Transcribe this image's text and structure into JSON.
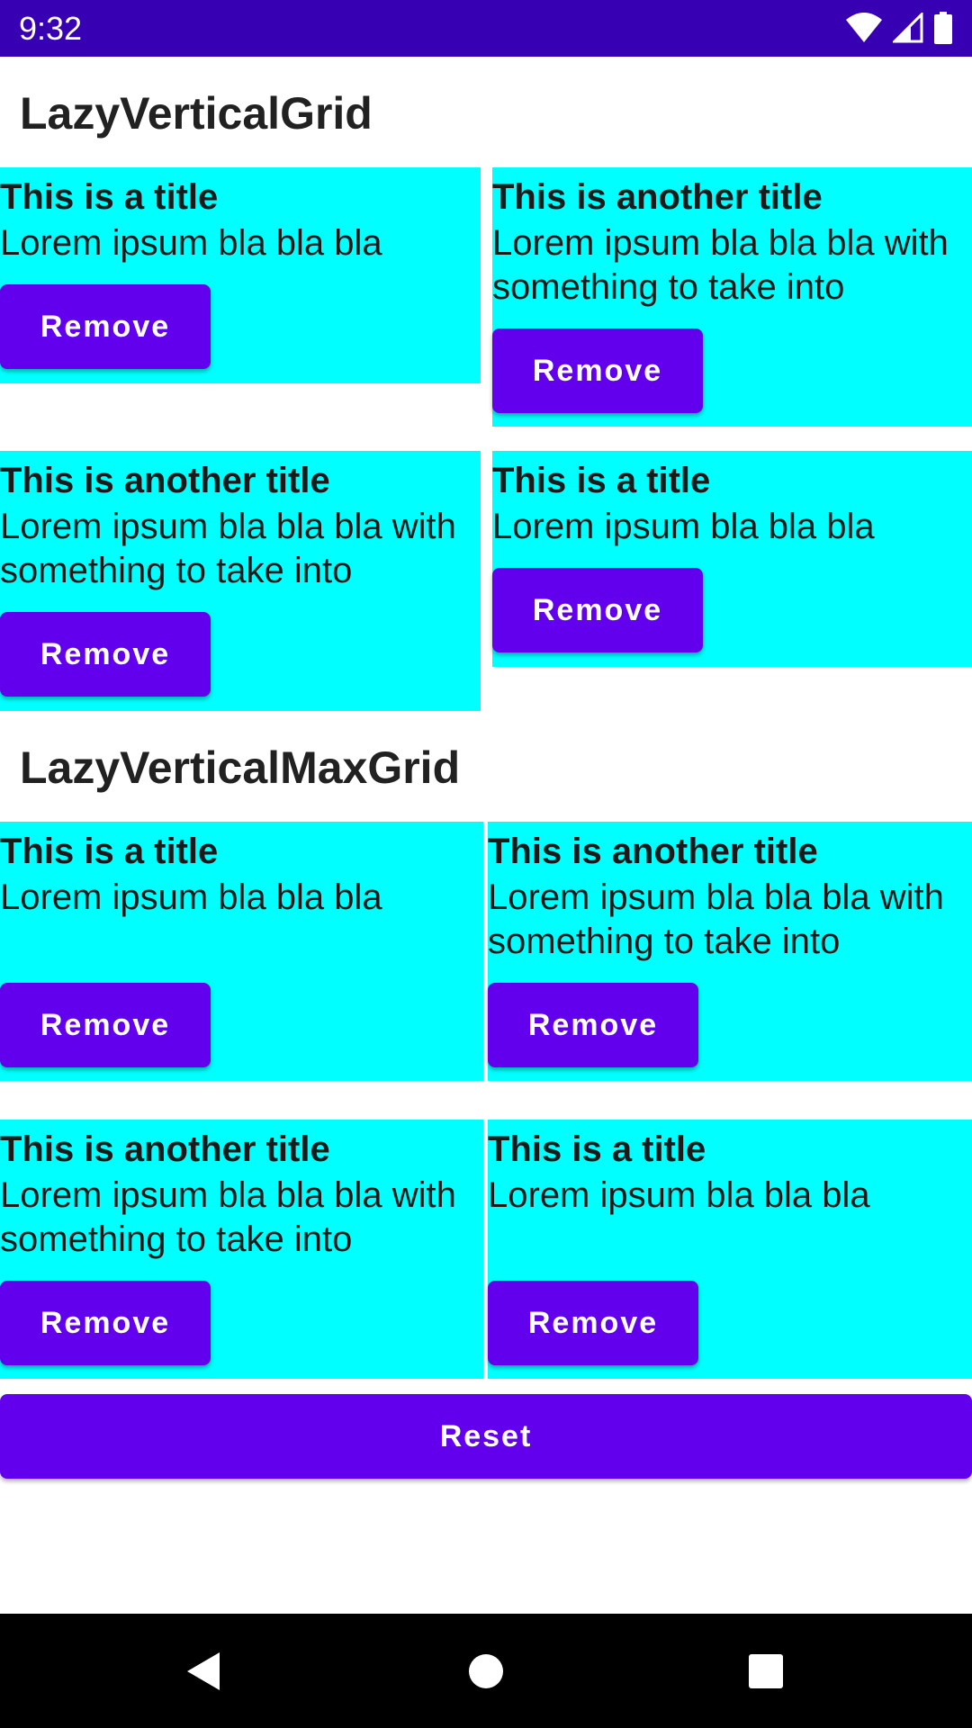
{
  "status_bar": {
    "time": "9:32",
    "icons": [
      "wifi-icon",
      "cell-signal-icon",
      "battery-icon"
    ],
    "background": "#3700b3"
  },
  "sections": [
    {
      "title": "LazyVerticalGrid",
      "cards": [
        {
          "title": "This is a title",
          "body": "Lorem ipsum bla bla bla",
          "button": "Remove"
        },
        {
          "title": "This is another title",
          "body": "Lorem ipsum bla bla bla with something to take into",
          "button": "Remove"
        },
        {
          "title": "This is another title",
          "body": "Lorem ipsum bla bla bla with something to take into",
          "button": "Remove"
        },
        {
          "title": "This is a title",
          "body": "Lorem ipsum bla bla bla",
          "button": "Remove"
        }
      ]
    },
    {
      "title": "LazyVerticalMaxGrid",
      "cards": [
        {
          "title": "This is a title",
          "body": "Lorem ipsum bla bla bla",
          "button": "Remove"
        },
        {
          "title": "This is another title",
          "body": "Lorem ipsum bla bla bla with something to take into",
          "button": "Remove"
        },
        {
          "title": "This is another title",
          "body": "Lorem ipsum bla bla bla with something to take into",
          "button": "Remove"
        },
        {
          "title": "This is a title",
          "body": "Lorem ipsum bla bla bla",
          "button": "Remove"
        }
      ]
    }
  ],
  "reset_label": "Reset",
  "colors": {
    "card": "#00ffff",
    "button": "#6200ee",
    "status_bar": "#3700b3",
    "nav_bar": "#000000"
  },
  "nav_bar": {
    "icons": [
      "back-icon",
      "home-icon",
      "recents-icon"
    ]
  }
}
